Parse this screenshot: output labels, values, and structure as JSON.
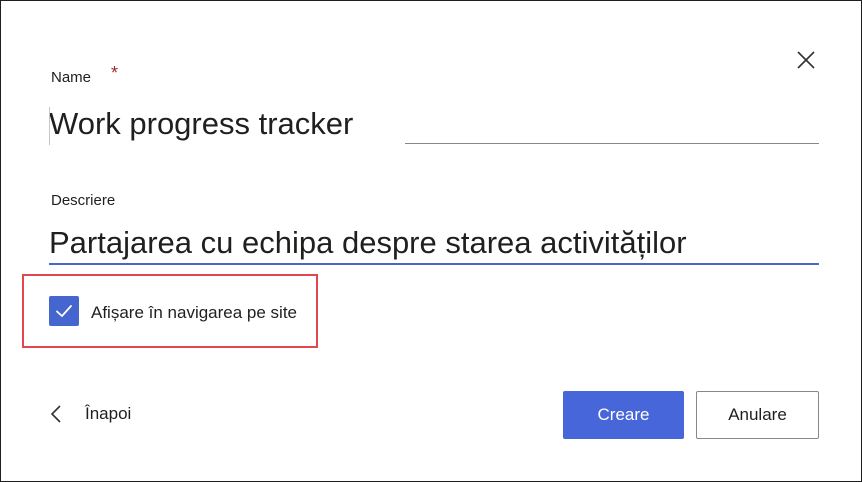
{
  "dialog": {
    "close_icon": "close-icon"
  },
  "form": {
    "name": {
      "label": "Name",
      "required_marker": "*",
      "value": "Work progress tracker"
    },
    "description": {
      "label": "Descriere",
      "value": "Partajarea cu echipa despre starea activităților"
    },
    "show_in_nav": {
      "label": "Afișare în navigarea pe site",
      "checked": true,
      "icon": "checkmark-icon"
    }
  },
  "footer": {
    "back_label": "Înapoi",
    "back_icon": "chevron-left-icon",
    "create_label": "Creare",
    "cancel_label": "Anulare"
  },
  "colors": {
    "accent": "#4666d9",
    "checkbox": "#4666cf",
    "focus_underline": "#4a67c6",
    "highlight_border": "#e2474e",
    "required": "#a4262c"
  }
}
